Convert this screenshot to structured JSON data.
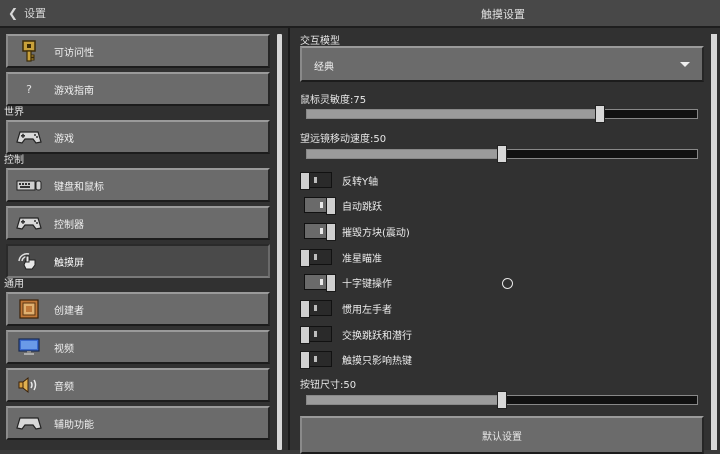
{
  "header": {
    "back_label": "设置",
    "title": "触摸设置"
  },
  "sidebar": {
    "groups": [
      {
        "title": "",
        "items": [
          {
            "label": "可访问性",
            "icon": "key-icon"
          },
          {
            "label": "游戏指南",
            "icon": "question-mark-icon"
          }
        ]
      },
      {
        "title": "世界",
        "items": [
          {
            "label": "游戏",
            "icon": "gamepad-icon"
          }
        ]
      },
      {
        "title": "控制",
        "items": [
          {
            "label": "键盘和鼠标",
            "icon": "keyboard-icon"
          },
          {
            "label": "控制器",
            "icon": "gamepad-icon"
          },
          {
            "label": "触摸屏",
            "icon": "touch-hand-icon"
          }
        ]
      },
      {
        "title": "通用",
        "items": [
          {
            "label": "创建者",
            "icon": "creator-icon"
          },
          {
            "label": "视频",
            "icon": "monitor-icon"
          },
          {
            "label": "音频",
            "icon": "speaker-icon"
          },
          {
            "label": "辅助功能",
            "icon": "gamepad-icon"
          }
        ]
      }
    ],
    "question_glyph": "?"
  },
  "settings": {
    "interaction_model": {
      "label": "交互模型",
      "value": "经典"
    },
    "mouse_sensitivity": {
      "label": "鼠标灵敏度:75",
      "value": 75
    },
    "telescope_speed": {
      "label": "望远镜移动速度:50",
      "value": 50
    },
    "toggles": [
      {
        "label": "反转Y轴",
        "on": false
      },
      {
        "label": "自动跳跃",
        "on": true
      },
      {
        "label": "摧毁方块(震动)",
        "on": true
      },
      {
        "label": "准星瞄准",
        "on": false
      },
      {
        "label": "十字键操作",
        "on": true
      },
      {
        "label": "惯用左手者",
        "on": false
      },
      {
        "label": "交换跳跃和潜行",
        "on": false
      },
      {
        "label": "触摸只影响热键",
        "on": false
      }
    ],
    "button_size": {
      "label": "按钮尺寸:50",
      "value": 50
    },
    "reset_label": "默认设置"
  }
}
